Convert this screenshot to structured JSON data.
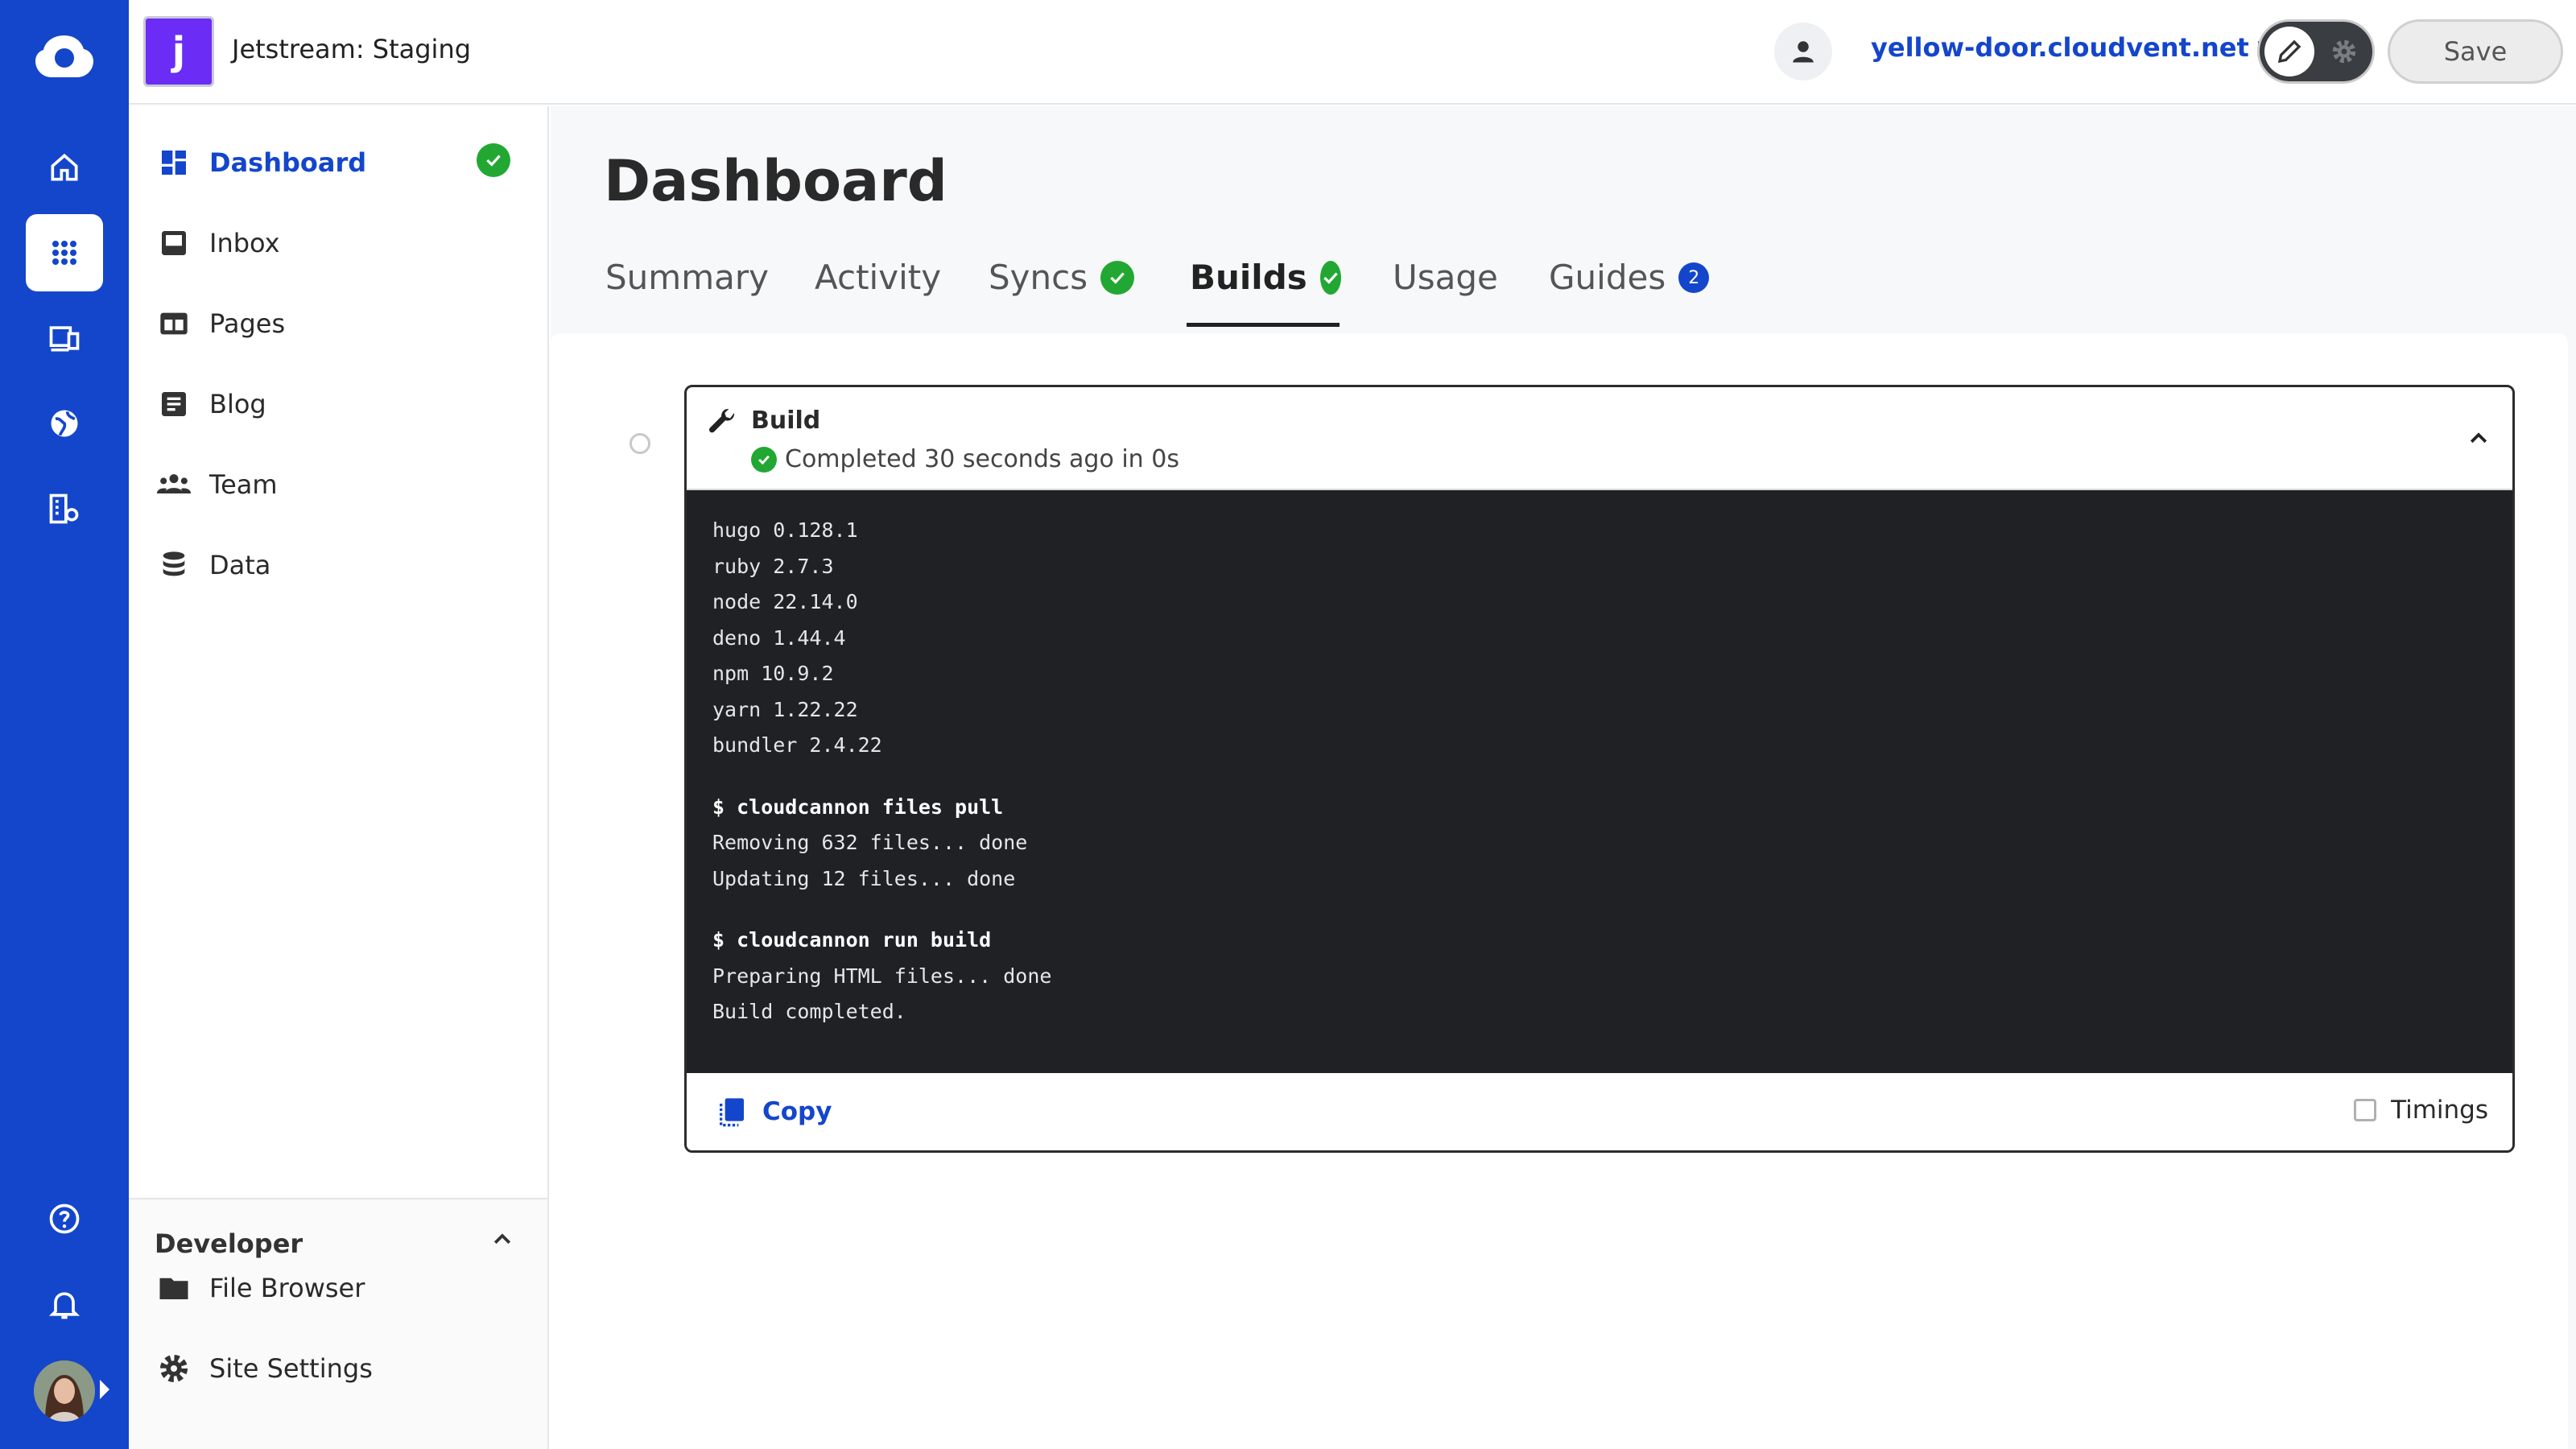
{
  "header": {
    "site_badge_letter": "j",
    "site_name": "Jetstream: Staging",
    "site_link": "yellow-door.cloudvent.net",
    "save_label": "Save"
  },
  "rail": {
    "items": [
      {
        "name": "home",
        "icon": "home-icon"
      },
      {
        "name": "apps",
        "icon": "grid-icon",
        "active": true
      },
      {
        "name": "devices",
        "icon": "devices-icon"
      },
      {
        "name": "globe",
        "icon": "globe-icon"
      },
      {
        "name": "organization",
        "icon": "building-icon"
      },
      {
        "name": "help",
        "icon": "help-icon"
      },
      {
        "name": "notifications",
        "icon": "bell-icon"
      }
    ]
  },
  "sidebar": {
    "items": [
      {
        "label": "Dashboard",
        "icon": "dashboard-icon",
        "active": true
      },
      {
        "label": "Inbox",
        "icon": "inbox-icon"
      },
      {
        "label": "Pages",
        "icon": "pages-icon"
      },
      {
        "label": "Blog",
        "icon": "blog-icon"
      },
      {
        "label": "Team",
        "icon": "team-icon"
      },
      {
        "label": "Data",
        "icon": "data-icon"
      }
    ],
    "developer": {
      "title": "Developer",
      "items": [
        {
          "label": "File Browser",
          "icon": "folder-icon"
        },
        {
          "label": "Site Settings",
          "icon": "gear-icon"
        }
      ]
    }
  },
  "main": {
    "title": "Dashboard",
    "tabs": [
      {
        "label": "Summary"
      },
      {
        "label": "Activity"
      },
      {
        "label": "Syncs",
        "badge": "check"
      },
      {
        "label": "Builds",
        "badge": "check",
        "active": true
      },
      {
        "label": "Usage"
      },
      {
        "label": "Guides",
        "count": "2"
      }
    ],
    "build": {
      "title": "Build",
      "status": "Completed 30 seconds ago in 0s",
      "log": {
        "versions": [
          "hugo 0.128.1",
          "ruby 2.7.3",
          "node 22.14.0",
          "deno 1.44.4",
          "npm 10.9.2",
          "yarn 1.22.22",
          "bundler 2.4.22"
        ],
        "cmd1": "$ cloudcannon files pull",
        "cmd1_out": [
          "Removing 632 files... done",
          "Updating 12 files... done"
        ],
        "cmd2": "$ cloudcannon run build",
        "cmd2_out": [
          "Preparing HTML files... done",
          "Build completed."
        ]
      },
      "copy_label": "Copy",
      "timings_label": "Timings"
    }
  },
  "colors": {
    "brand": "#1446cc",
    "success": "#22a832",
    "terminal_bg": "#1f2125",
    "site_badge": "#6b2cf5"
  }
}
